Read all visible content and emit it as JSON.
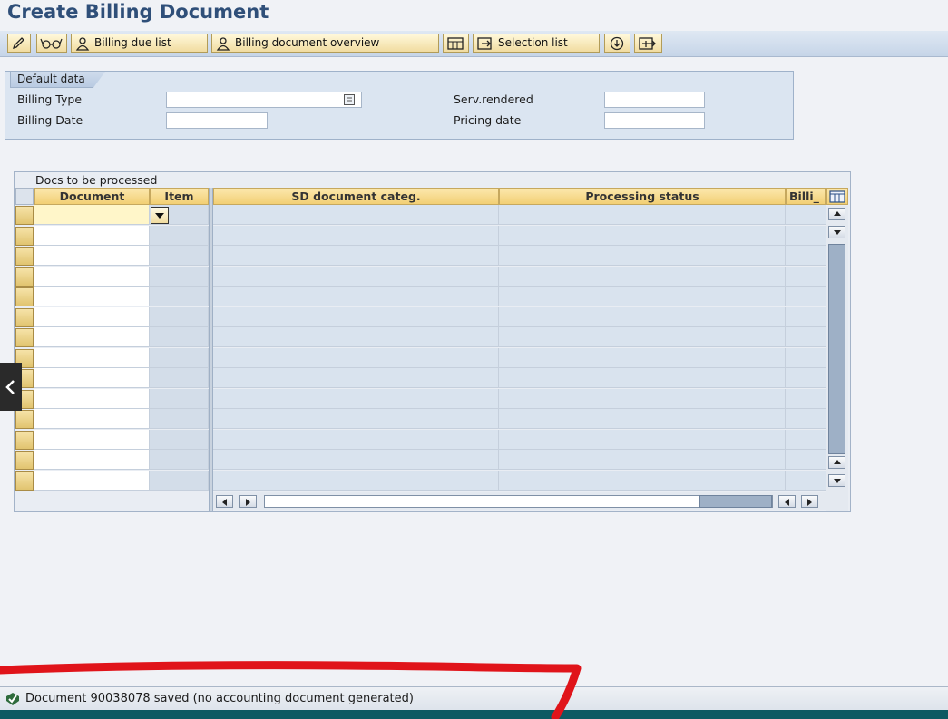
{
  "app": {
    "title": "Create Billing Document"
  },
  "toolbar": {
    "billing_due_list": "Billing due list",
    "billing_document_overview": "Billing document overview",
    "selection_list": "Selection list"
  },
  "default_data": {
    "group_title": "Default data",
    "billing_type_label": "Billing Type",
    "billing_type_value": "",
    "billing_date_label": "Billing Date",
    "billing_date_value": "",
    "serv_rendered_label": "Serv.rendered",
    "serv_rendered_value": "",
    "pricing_date_label": "Pricing date",
    "pricing_date_value": ""
  },
  "docs_table": {
    "title": "Docs to be processed",
    "columns": [
      "Document",
      "Item",
      "SD document categ.",
      "Processing status",
      "Billi_"
    ],
    "visible_rows": 14
  },
  "status": {
    "message": "Document 90038078 saved (no accounting document generated)",
    "type": "success"
  },
  "colors": {
    "title": "#2f4f79",
    "annotation": "#e0141a",
    "header_yellow": "#f2cf74",
    "bottom_strip": "#0c5a63"
  }
}
